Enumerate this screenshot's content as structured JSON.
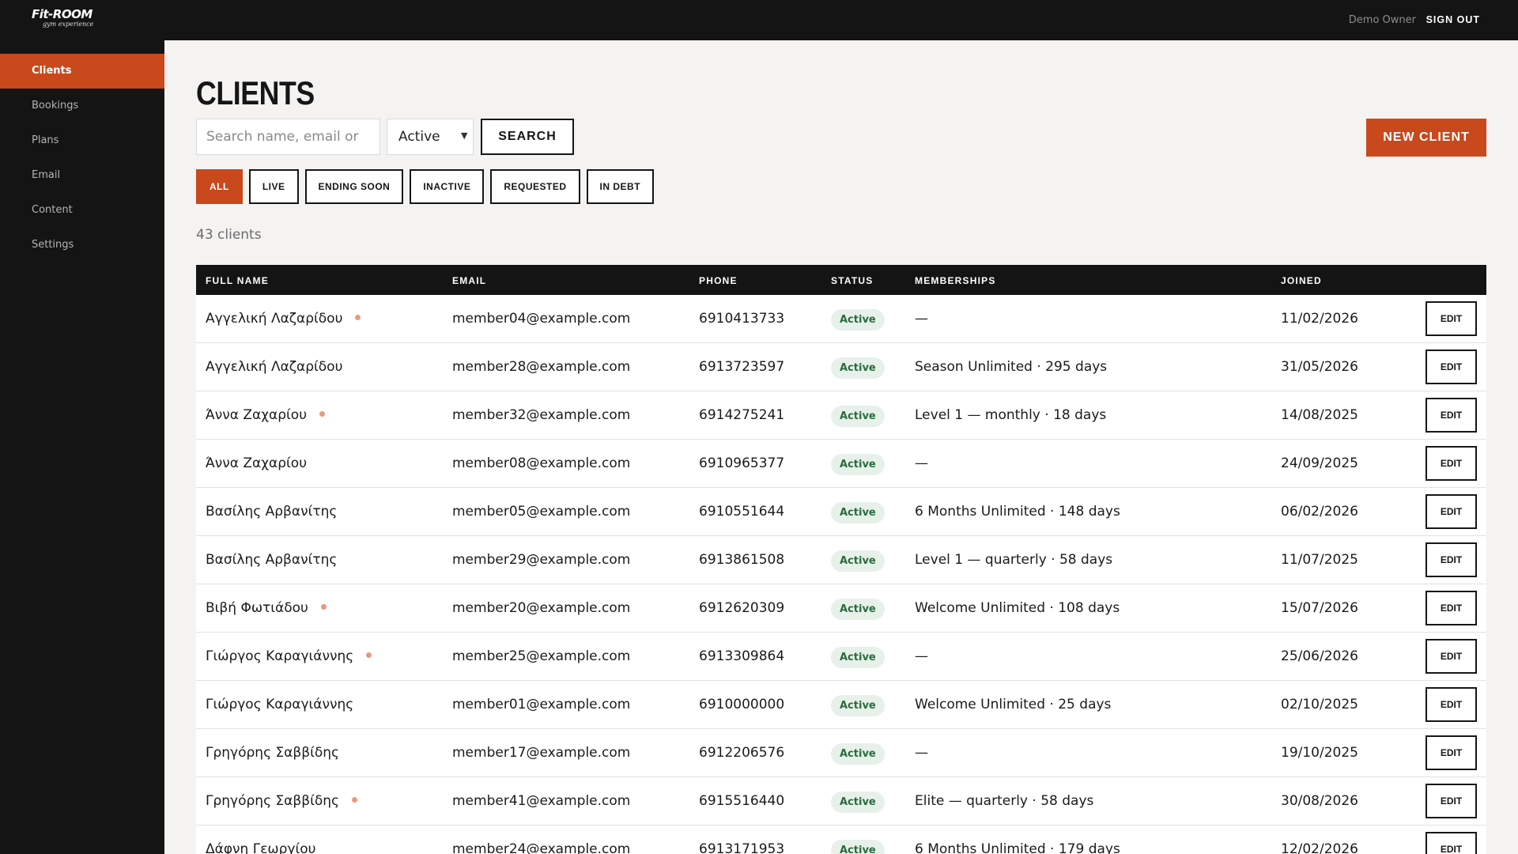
{
  "brand": {
    "logo": "Fit-ROOM",
    "tagline": "gym experience"
  },
  "header": {
    "user_name": "Demo Owner",
    "sign_out": "SIGN OUT"
  },
  "sidebar": {
    "items": [
      {
        "label": "Clients",
        "active": true
      },
      {
        "label": "Bookings",
        "active": false
      },
      {
        "label": "Plans",
        "active": false
      },
      {
        "label": "Email",
        "active": false
      },
      {
        "label": "Content",
        "active": false
      },
      {
        "label": "Settings",
        "active": false
      }
    ]
  },
  "page": {
    "title": "CLIENTS",
    "search_placeholder": "Search name, email or",
    "status_selected": "Active",
    "search_label": "SEARCH",
    "new_client_label": "NEW CLIENT",
    "count_text": "43 clients"
  },
  "filters": [
    {
      "label": "ALL",
      "active": true
    },
    {
      "label": "LIVE",
      "active": false
    },
    {
      "label": "ENDING SOON",
      "active": false
    },
    {
      "label": "INACTIVE",
      "active": false
    },
    {
      "label": "REQUESTED",
      "active": false
    },
    {
      "label": "IN DEBT",
      "active": false
    }
  ],
  "table": {
    "columns": [
      "FULL NAME",
      "EMAIL",
      "PHONE",
      "STATUS",
      "MEMBERSHIPS",
      "JOINED"
    ],
    "edit_label": "EDIT",
    "rows": [
      {
        "name": "Αγγελική Λαζαρίδου",
        "flag": true,
        "email": "member04@example.com",
        "phone": "6910413733",
        "status": "Active",
        "membership": "—",
        "joined": "11/02/2026"
      },
      {
        "name": "Αγγελική Λαζαρίδου",
        "flag": false,
        "email": "member28@example.com",
        "phone": "6913723597",
        "status": "Active",
        "membership": "Season Unlimited · 295 days",
        "joined": "31/05/2026"
      },
      {
        "name": "Άννα Ζαχαρίου",
        "flag": true,
        "email": "member32@example.com",
        "phone": "6914275241",
        "status": "Active",
        "membership": "Level 1 — monthly · 18 days",
        "joined": "14/08/2025"
      },
      {
        "name": "Άννα Ζαχαρίου",
        "flag": false,
        "email": "member08@example.com",
        "phone": "6910965377",
        "status": "Active",
        "membership": "—",
        "joined": "24/09/2025"
      },
      {
        "name": "Βασίλης Αρβανίτης",
        "flag": false,
        "email": "member05@example.com",
        "phone": "6910551644",
        "status": "Active",
        "membership": "6 Months Unlimited · 148 days",
        "joined": "06/02/2026"
      },
      {
        "name": "Βασίλης Αρβανίτης",
        "flag": false,
        "email": "member29@example.com",
        "phone": "6913861508",
        "status": "Active",
        "membership": "Level 1 — quarterly · 58 days",
        "joined": "11/07/2025"
      },
      {
        "name": "Βιβή Φωτιάδου",
        "flag": true,
        "email": "member20@example.com",
        "phone": "6912620309",
        "status": "Active",
        "membership": "Welcome Unlimited · 108 days",
        "joined": "15/07/2026"
      },
      {
        "name": "Γιώργος Καραγιάννης",
        "flag": true,
        "email": "member25@example.com",
        "phone": "6913309864",
        "status": "Active",
        "membership": "—",
        "joined": "25/06/2026"
      },
      {
        "name": "Γιώργος Καραγιάννης",
        "flag": false,
        "email": "member01@example.com",
        "phone": "6910000000",
        "status": "Active",
        "membership": "Welcome Unlimited · 25 days",
        "joined": "02/10/2025"
      },
      {
        "name": "Γρηγόρης Σαββίδης",
        "flag": false,
        "email": "member17@example.com",
        "phone": "6912206576",
        "status": "Active",
        "membership": "—",
        "joined": "19/10/2025"
      },
      {
        "name": "Γρηγόρης Σαββίδης",
        "flag": true,
        "email": "member41@example.com",
        "phone": "6915516440",
        "status": "Active",
        "membership": "Elite — quarterly · 58 days",
        "joined": "30/08/2026"
      },
      {
        "name": "Δάφνη Γεωργίου",
        "flag": false,
        "email": "member24@example.com",
        "phone": "6913171953",
        "status": "Active",
        "membership": "6 Months Unlimited · 179 days",
        "joined": "12/02/2026"
      }
    ]
  },
  "colors": {
    "accent": "#c9481c",
    "dark": "#141414",
    "status_bg": "#e7f1ea",
    "status_fg": "#2a6b3f",
    "flag_dot": "#e89a7c"
  }
}
